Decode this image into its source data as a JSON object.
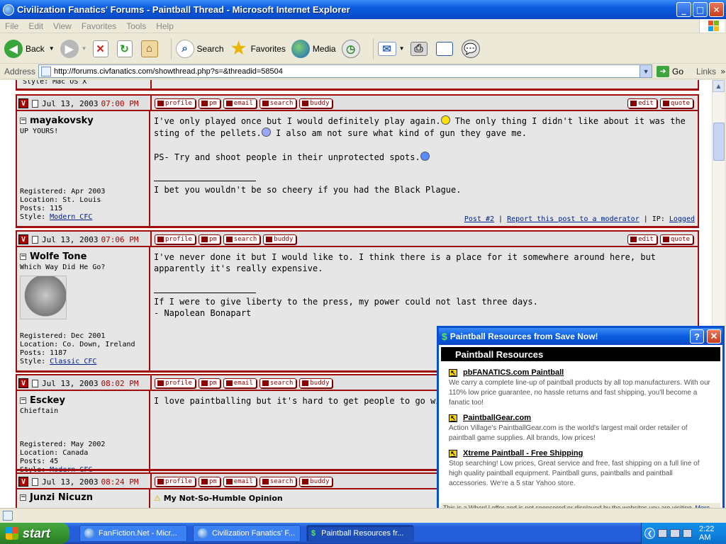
{
  "window": {
    "title": "Civilization Fanatics' Forums - Paintball Thread - Microsoft Internet Explorer",
    "buttons": {
      "minimize": "_",
      "maximize": "□",
      "close": "✕"
    }
  },
  "menu": [
    "File",
    "Edit",
    "View",
    "Favorites",
    "Tools",
    "Help"
  ],
  "toolbar": {
    "back": "Back",
    "search": "Search",
    "favorites": "Favorites",
    "media": "Media"
  },
  "address": {
    "label": "Address",
    "url": "http://forums.civfanatics.com/showthread.php?s=&threadid=58504",
    "go": "Go",
    "links": "Links"
  },
  "thread": {
    "prev_style": "Style: Mac OS X",
    "buttons": {
      "profile": "profile",
      "pm": "pm",
      "email": "email",
      "search": "search",
      "buddy": "buddy",
      "edit": "edit",
      "quote": "quote"
    },
    "posts": [
      {
        "date": "Jul 13, 2003",
        "time": "07:00 PM",
        "user": "mayakovsky",
        "title": "UP YOURS!",
        "registered": "Registered: Apr 2003",
        "location": "Location: St. Louis",
        "posts": "Posts: 115",
        "style_label": "Style:",
        "style": "Modern CFC",
        "line1a": "I've only played once but I would definitely play again.",
        "line1b": " The only thing I didn't like about it was the sting of the pellets.",
        "line1c": " I also am not sure what kind of gun they gave me.",
        "line2": "PS- Try and shoot people in their unprotected spots.",
        "sig": "I bet you wouldn't be so cheery if you had the Black Plague.",
        "post_link": "Post #2",
        "report_link": "Report this post to a moderator",
        "ip_label": "IP:",
        "ip": "Logged"
      },
      {
        "date": "Jul 13, 2003",
        "time": "07:06 PM",
        "user": "Wolfe Tone",
        "title": "Which Way Did He Go?",
        "registered": "Registered: Dec 2001",
        "location": "Location: Co. Down, Ireland",
        "posts": "Posts: 1187",
        "style_label": "Style:",
        "style": "Classic CFC",
        "message": "I've never done it but I would like to. I think there is a place for it somewhere around here, but apparently it's really expensive.",
        "sig1": "If I were to give liberty to the press, my power could not last three days.",
        "sig2": "- Napolean Bonapart"
      },
      {
        "date": "Jul 13, 2003",
        "time": "08:02 PM",
        "user": "Esckey",
        "title": "Chieftain",
        "registered": "Registered: May 2002",
        "location": "Location: Canada",
        "posts": "Posts: 45",
        "style_label": "Style:",
        "style": "Modern CFC",
        "message": "I love paintballing but it's hard to get people to go with you"
      },
      {
        "date": "Jul 13, 2003",
        "time": "08:24 PM",
        "user": "Junzi Nicuzn",
        "message_title": "My Not-So-Humble Opinion"
      }
    ]
  },
  "popup": {
    "title": "Paintball Resources from Save Now!",
    "help": "?",
    "close": "✕",
    "heading": "Paintball Resources",
    "items": [
      {
        "link": "pbFANATICS.com Paintball",
        "desc": "We carry a complete line-up of paintball products by all top manufacturers. With our 110% low price guarantee, no hassle returns and fast shipping, you'll become a fanatic too!"
      },
      {
        "link": "PaintballGear.com",
        "desc": "Action Village's PaintballGear.com is the world's largest mail order retailer of paintball game supplies. All brands, low prices!"
      },
      {
        "link": "Xtreme Paintball - Free Shipping",
        "desc": "Stop searching! Low prices, Great service and free, fast shipping on a full line of high quality paintball equipment. Paintball guns, paintballs and paintball accessories. We're a 5 star Yahoo store."
      }
    ],
    "footer": "This is a WhenU offer and is not sponsored or displayed by the websites you are visiting.",
    "more": "More..."
  },
  "taskbar": {
    "start": "start",
    "tasks": [
      "FanFiction.Net - Micr...",
      "Civilization Fanatics' F...",
      "Paintball Resources fr..."
    ],
    "clock": "2:22 AM"
  }
}
